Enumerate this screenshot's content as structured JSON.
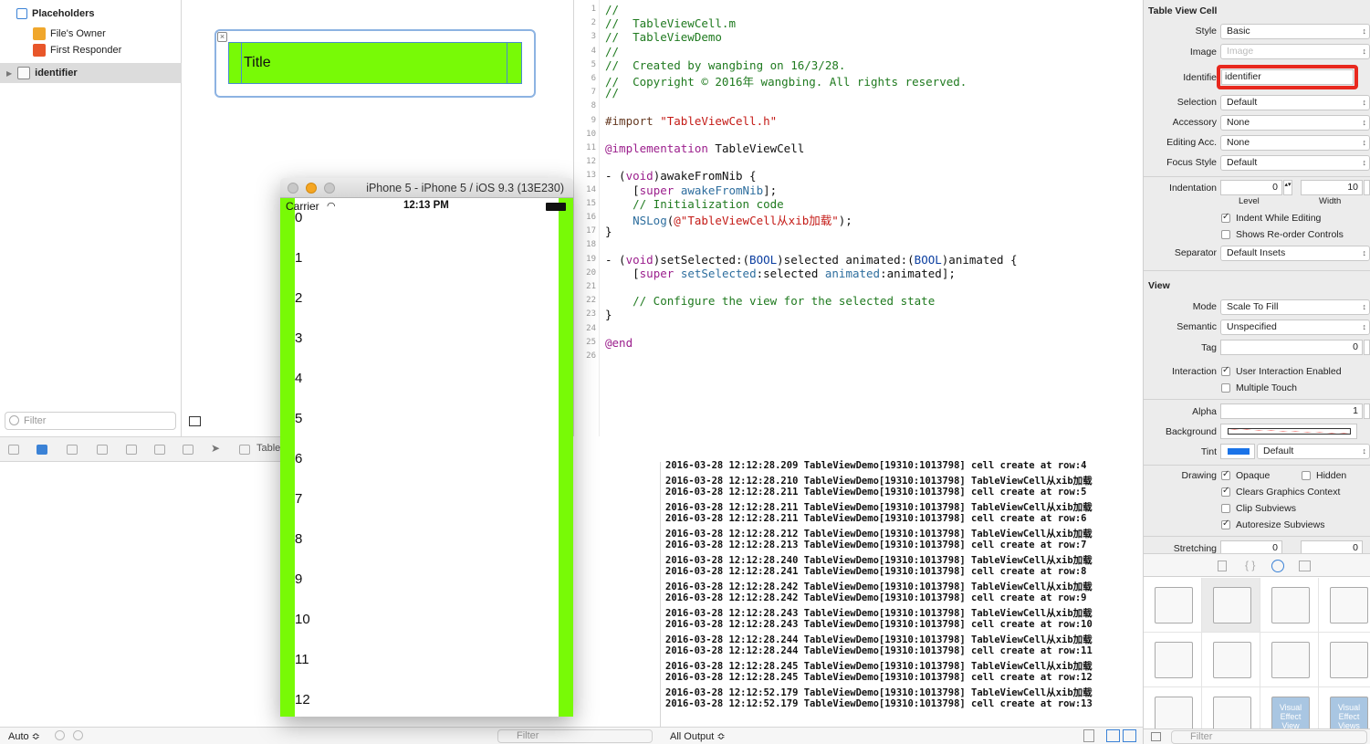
{
  "outline": {
    "placeholders": "Placeholders",
    "files_owner": "File's Owner",
    "first_responder": "First Responder",
    "identifier": "identifier",
    "filter_placeholder": "Filter"
  },
  "canvas": {
    "cell_title": "Title"
  },
  "toolbar": {
    "label": "Table"
  },
  "simulator": {
    "title": "iPhone 5 - iPhone 5 / iOS 9.3 (13E230)",
    "carrier": "Carrier",
    "time": "12:13 PM",
    "rows": [
      "0",
      "1",
      "2",
      "3",
      "4",
      "5",
      "6",
      "7",
      "8",
      "9",
      "10",
      "11",
      "12"
    ]
  },
  "editor": {
    "line_numbers": [
      "1",
      "2",
      "3",
      "4",
      "5",
      "6",
      "7",
      "8",
      "9",
      "10",
      "11",
      "12",
      "13",
      "14",
      "15",
      "16",
      "17",
      "18",
      "19",
      "20",
      "21",
      "22",
      "23",
      "24",
      "25",
      "26"
    ],
    "lines": [
      "//",
      "//  TableViewCell.m",
      "//  TableViewDemo",
      "//",
      "//  Created by wangbing on 16/3/28.",
      "//  Copyright © 2016年 wangbing. All rights reserved.",
      "//",
      "",
      "#import \"TableViewCell.h\"",
      "",
      "@implementation TableViewCell",
      "",
      "- (void)awakeFromNib {",
      "    [super awakeFromNib];",
      "    // Initialization code",
      "    NSLog(@\"TableViewCell从xib加载\");",
      "}",
      "",
      "- (void)setSelected:(BOOL)selected animated:(BOOL)animated {",
      "    [super setSelected:selected animated:animated];",
      "",
      "    // Configure the view for the selected state",
      "}",
      "",
      "@end",
      ""
    ]
  },
  "console": {
    "lines": [
      "2016-03-28 12:12:28.209 TableViewDemo[19310:1013798] cell create at row:4",
      "2016-03-28 12:12:28.210 TableViewDemo[19310:1013798] TableViewCell从xib加载",
      "2016-03-28 12:12:28.211 TableViewDemo[19310:1013798] cell create at row:5",
      "2016-03-28 12:12:28.211 TableViewDemo[19310:1013798] TableViewCell从xib加载",
      "2016-03-28 12:12:28.211 TableViewDemo[19310:1013798] cell create at row:6",
      "2016-03-28 12:12:28.212 TableViewDemo[19310:1013798] TableViewCell从xib加载",
      "2016-03-28 12:12:28.213 TableViewDemo[19310:1013798] cell create at row:7",
      "2016-03-28 12:12:28.240 TableViewDemo[19310:1013798] TableViewCell从xib加载",
      "2016-03-28 12:12:28.241 TableViewDemo[19310:1013798] cell create at row:8",
      "2016-03-28 12:12:28.242 TableViewDemo[19310:1013798] TableViewCell从xib加载",
      "2016-03-28 12:12:28.242 TableViewDemo[19310:1013798] cell create at row:9",
      "2016-03-28 12:12:28.243 TableViewDemo[19310:1013798] TableViewCell从xib加载",
      "2016-03-28 12:12:28.243 TableViewDemo[19310:1013798] cell create at row:10",
      "2016-03-28 12:12:28.244 TableViewDemo[19310:1013798] TableViewCell从xib加载",
      "2016-03-28 12:12:28.244 TableViewDemo[19310:1013798] cell create at row:11",
      "2016-03-28 12:12:28.245 TableViewDemo[19310:1013798] TableViewCell从xib加载",
      "2016-03-28 12:12:28.245 TableViewDemo[19310:1013798] cell create at row:12",
      "2016-03-28 12:12:52.179 TableViewDemo[19310:1013798] TableViewCell从xib加载",
      "2016-03-28 12:12:52.179 TableViewDemo[19310:1013798] cell create at row:13"
    ]
  },
  "bottom_bar": {
    "auto": "Auto ≎",
    "filter": "Filter",
    "all_output": "All Output ≎"
  },
  "inspector": {
    "section_cell": "Table View Cell",
    "style_label": "Style",
    "style_value": "Basic",
    "image_label": "Image",
    "image_placeholder": "Image",
    "identifier_label": "Identifie",
    "identifier_value": "identifier",
    "selection_label": "Selection",
    "selection_value": "Default",
    "accessory_label": "Accessory",
    "accessory_value": "None",
    "editing_label": "Editing Acc.",
    "editing_value": "None",
    "focus_label": "Focus Style",
    "focus_value": "Default",
    "indentation_label": "Indentation",
    "indent_level": "0",
    "indent_width": "10",
    "level_label": "Level",
    "width_label": "Width",
    "indent_while_editing": "Indent While Editing",
    "shows_reorder": "Shows Re-order Controls",
    "separator_label": "Separator",
    "separator_value": "Default Insets",
    "section_view": "View",
    "mode_label": "Mode",
    "mode_value": "Scale To Fill",
    "semantic_label": "Semantic",
    "semantic_value": "Unspecified",
    "tag_label": "Tag",
    "tag_value": "0",
    "interaction_label": "Interaction",
    "user_interaction": "User Interaction Enabled",
    "multiple_touch": "Multiple Touch",
    "alpha_label": "Alpha",
    "alpha_value": "1",
    "background_label": "Background",
    "tint_label": "Tint",
    "tint_value": "Default",
    "drawing_label": "Drawing",
    "opaque": "Opaque",
    "hidden": "Hidden",
    "clears_graphics": "Clears Graphics Context",
    "clip_subviews": "Clip Subviews",
    "autoresize": "Autoresize Subviews",
    "stretching_label": "Stretching",
    "stretch_x": "0",
    "stretch_y": "0"
  },
  "library": {
    "visual_effect_view": "Visual Effect View",
    "visual_effect_views": "Visual Effect Views",
    "filter": "Filter"
  },
  "colors": {
    "cell_green": "#78fa06",
    "highlight_red": "#e8281e",
    "selection_blue": "#4a8bd0"
  }
}
